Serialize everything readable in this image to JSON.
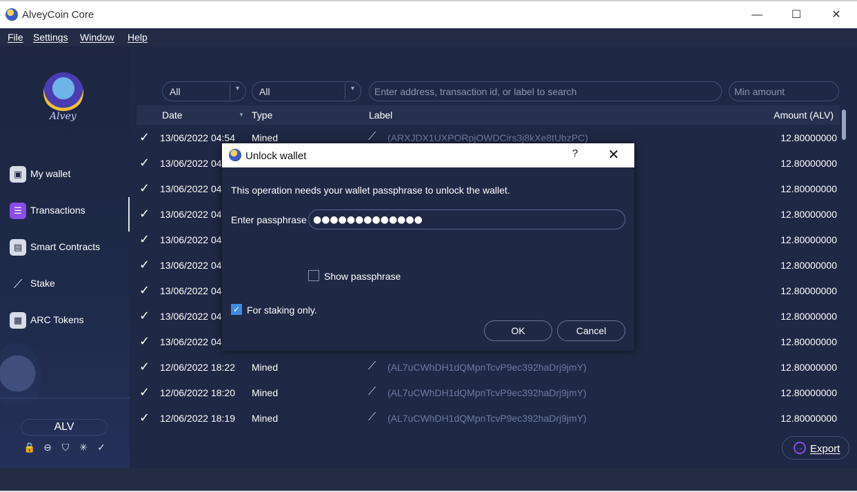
{
  "window": {
    "title": "AlveyCoin Core",
    "minimize_glyph": "—",
    "maximize_glyph": "☐",
    "close_glyph": "✕"
  },
  "menu": [
    "File",
    "Settings",
    "Window",
    "Help"
  ],
  "sidebar": {
    "logo_text": "Alvey",
    "items": [
      {
        "label": "My wallet",
        "icon": "wallet-icon",
        "glyph": "▣"
      },
      {
        "label": "Transactions",
        "icon": "transactions-icon",
        "glyph": "☰"
      },
      {
        "label": "Smart Contracts",
        "icon": "smart-contracts-icon",
        "glyph": "▤"
      },
      {
        "label": "Stake",
        "icon": "stake-icon",
        "glyph": "⟋"
      },
      {
        "label": "ARC Tokens",
        "icon": "arc-tokens-icon",
        "glyph": "▦"
      }
    ],
    "unit": "ALV",
    "status_icons": [
      {
        "name": "lock-icon",
        "glyph": "🔒"
      },
      {
        "name": "minus-circle-icon",
        "glyph": "⊖"
      },
      {
        "name": "shield-icon",
        "glyph": "⛉"
      },
      {
        "name": "network-icon",
        "glyph": "✳"
      },
      {
        "name": "synced-check-icon",
        "glyph": "✓"
      }
    ]
  },
  "filters": {
    "date_filter": "All",
    "type_filter": "All",
    "search_placeholder": "Enter address, transaction id, or label to search",
    "min_amount_placeholder": "Min amount"
  },
  "table": {
    "columns": [
      "Date",
      "Type",
      "Label",
      "Amount (ALV)"
    ],
    "rows": [
      {
        "date": "13/06/2022 04:54",
        "type": "Mined",
        "label": "(ARXJDX1UXPORpjOWDCirs3j8kXe8tUbzPC)",
        "amount": "12.80000000"
      },
      {
        "date": "13/06/2022 04",
        "type": "",
        "label": "",
        "amount": "12.80000000"
      },
      {
        "date": "13/06/2022 04",
        "type": "",
        "label": "",
        "amount": "12.80000000"
      },
      {
        "date": "13/06/2022 04",
        "type": "",
        "label": "",
        "amount": "12.80000000"
      },
      {
        "date": "13/06/2022 04",
        "type": "",
        "label": "",
        "amount": "12.80000000"
      },
      {
        "date": "13/06/2022 04",
        "type": "",
        "label": "",
        "amount": "12.80000000"
      },
      {
        "date": "13/06/2022 04",
        "type": "",
        "label": "",
        "amount": "12.80000000"
      },
      {
        "date": "13/06/2022 04",
        "type": "",
        "label": "",
        "amount": "12.80000000"
      },
      {
        "date": "13/06/2022 04",
        "type": "",
        "label": "",
        "amount": "12.80000000"
      },
      {
        "date": "12/06/2022 18:22",
        "type": "Mined",
        "label": "(AL7uCWhDH1dQMpnTcvP9ec392haDrj9jmY)",
        "amount": "12.80000000"
      },
      {
        "date": "12/06/2022 18:20",
        "type": "Mined",
        "label": "(AL7uCWhDH1dQMpnTcvP9ec392haDrj9jmY)",
        "amount": "12.80000000"
      },
      {
        "date": "12/06/2022 18:19",
        "type": "Mined",
        "label": "(AL7uCWhDH1dQMpnTcvP9ec392haDrj9jmY)",
        "amount": "12.80000000"
      }
    ]
  },
  "export_label": "Export",
  "dialog": {
    "title": "Unlock wallet",
    "help": "?",
    "close": "✕",
    "message": "This operation needs your wallet passphrase to unlock the wallet.",
    "passphrase_label": "Enter passphrase",
    "passphrase_value": "●●●●●●●●●●●●●",
    "show_passphrase_label": "Show passphrase",
    "show_passphrase_checked": false,
    "staking_only_label": "For staking only.",
    "staking_only_checked": true,
    "ok_label": "OK",
    "cancel_label": "Cancel"
  },
  "colors": {
    "background": "#1f2844",
    "sidebar": "#1d2540",
    "accent": "#8a4de6",
    "checkbox": "#3d8be6"
  }
}
